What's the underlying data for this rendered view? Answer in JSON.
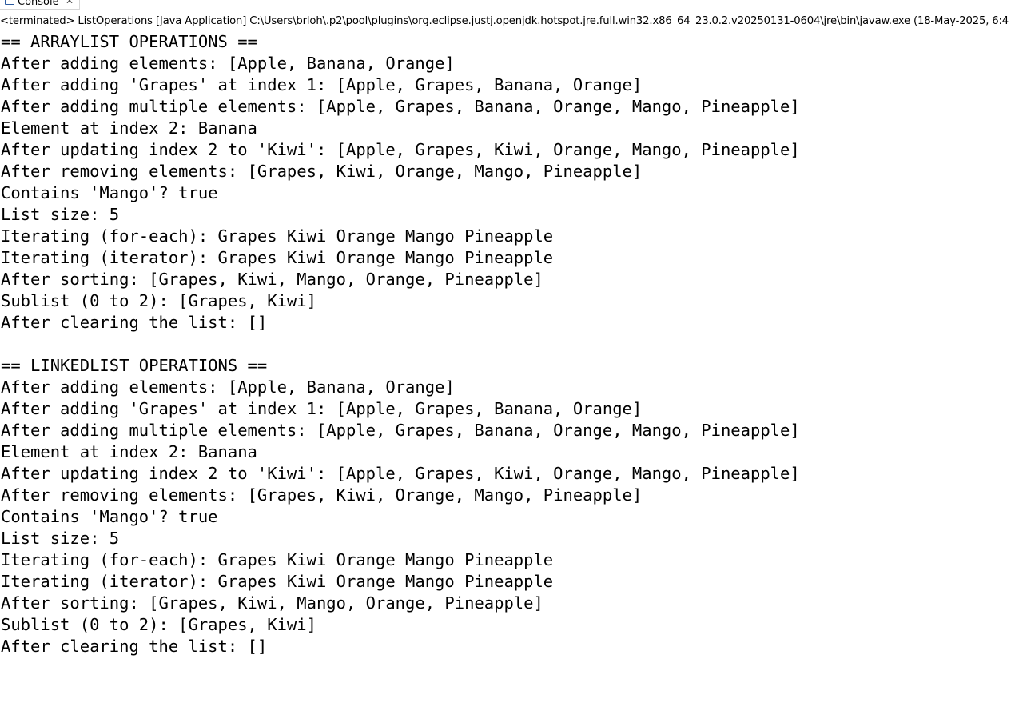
{
  "tab": {
    "label": "Console",
    "icon": "console-icon",
    "close_glyph": "✕"
  },
  "status": {
    "text": "<terminated> ListOperations [Java Application] C:\\Users\\brloh\\.p2\\pool\\plugins\\org.eclipse.justj.openjdk.hotspot.jre.full.win32.x86_64_23.0.2.v20250131-0604\\jre\\bin\\javaw.exe  (18-May-2025, 6:4"
  },
  "console": {
    "lines": [
      "== ARRAYLIST OPERATIONS ==",
      "After adding elements: [Apple, Banana, Orange]",
      "After adding 'Grapes' at index 1: [Apple, Grapes, Banana, Orange]",
      "After adding multiple elements: [Apple, Grapes, Banana, Orange, Mango, Pineapple]",
      "Element at index 2: Banana",
      "After updating index 2 to 'Kiwi': [Apple, Grapes, Kiwi, Orange, Mango, Pineapple]",
      "After removing elements: [Grapes, Kiwi, Orange, Mango, Pineapple]",
      "Contains 'Mango'? true",
      "List size: 5",
      "Iterating (for-each): Grapes Kiwi Orange Mango Pineapple",
      "Iterating (iterator): Grapes Kiwi Orange Mango Pineapple",
      "After sorting: [Grapes, Kiwi, Mango, Orange, Pineapple]",
      "Sublist (0 to 2): [Grapes, Kiwi]",
      "After clearing the list: []",
      "",
      "== LINKEDLIST OPERATIONS ==",
      "After adding elements: [Apple, Banana, Orange]",
      "After adding 'Grapes' at index 1: [Apple, Grapes, Banana, Orange]",
      "After adding multiple elements: [Apple, Grapes, Banana, Orange, Mango, Pineapple]",
      "Element at index 2: Banana",
      "After updating index 2 to 'Kiwi': [Apple, Grapes, Kiwi, Orange, Mango, Pineapple]",
      "After removing elements: [Grapes, Kiwi, Orange, Mango, Pineapple]",
      "Contains 'Mango'? true",
      "List size: 5",
      "Iterating (for-each): Grapes Kiwi Orange Mango Pineapple",
      "Iterating (iterator): Grapes Kiwi Orange Mango Pineapple",
      "After sorting: [Grapes, Kiwi, Mango, Orange, Pineapple]",
      "Sublist (0 to 2): [Grapes, Kiwi]",
      "After clearing the list: []"
    ]
  }
}
